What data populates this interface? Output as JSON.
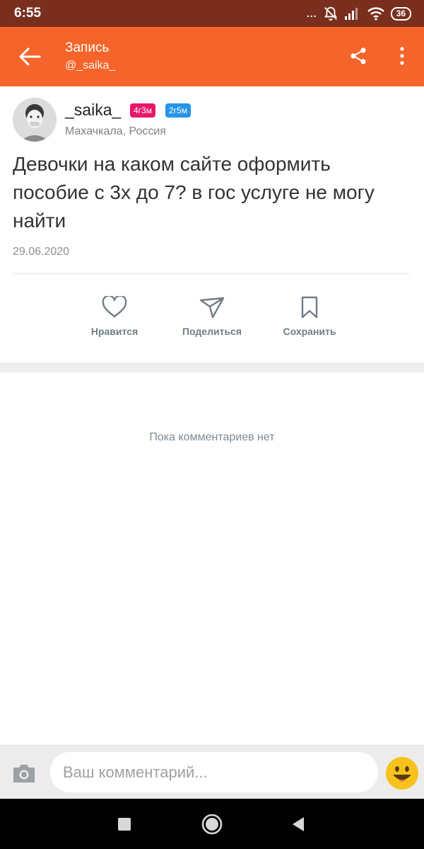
{
  "status_bar": {
    "time": "6:55",
    "dots": "...",
    "battery": "36"
  },
  "header": {
    "title": "Запись",
    "subtitle": "@_saika_"
  },
  "post": {
    "author": "_saika_",
    "badges": [
      "4г3м",
      "2г5м"
    ],
    "location": "Махачкала, Россия",
    "text": "Девочки на каком сайте оформить пособие с 3х до 7? в гос услуге не могу найти",
    "date": "29.06.2020",
    "actions": {
      "like": "Нравится",
      "share": "Поделиться",
      "save": "Сохранить"
    }
  },
  "comments": {
    "empty_text": "Пока комментариев нет"
  },
  "comment_input": {
    "placeholder": "Ваш комментарий..."
  },
  "colors": {
    "accent": "#f5652b",
    "status_bar": "#7a2f1e",
    "badge_pink": "#e8176a",
    "badge_blue": "#2694e8",
    "icon_gray": "#6f7d86"
  }
}
